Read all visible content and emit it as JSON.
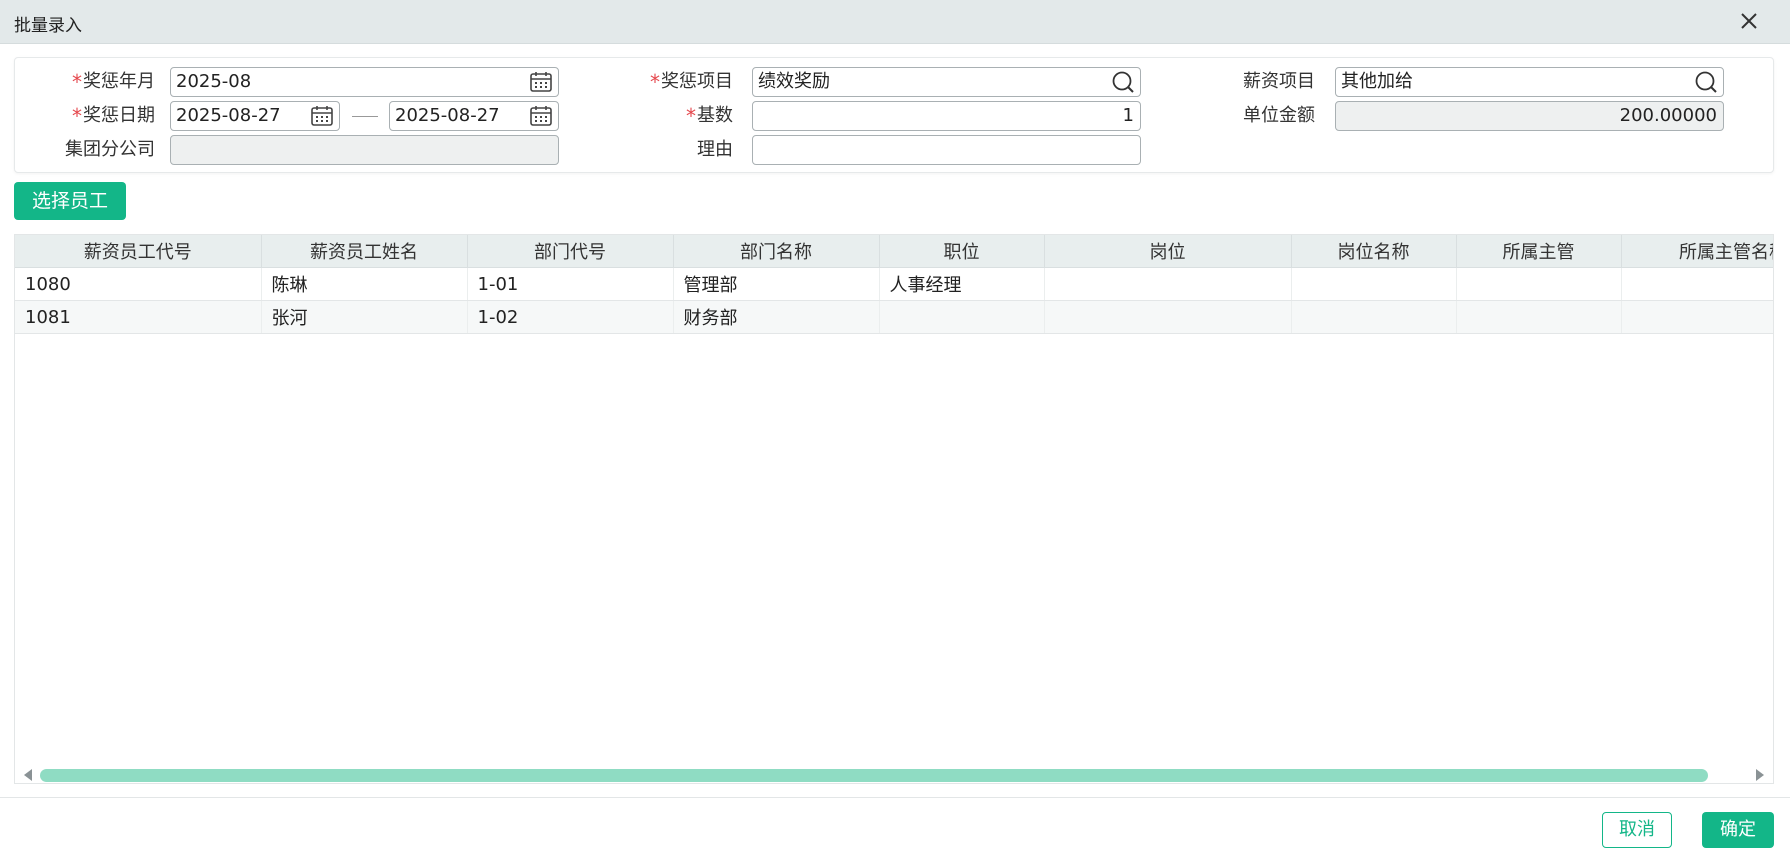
{
  "dialog": {
    "title": "批量录入"
  },
  "form": {
    "reward_month": {
      "label": "奖惩年月",
      "value": "2025-08"
    },
    "reward_date": {
      "label": "奖惩日期",
      "from": "2025-08-27",
      "to": "2025-08-27"
    },
    "group_company": {
      "label": "集团分公司",
      "value": ""
    },
    "reward_item": {
      "label": "奖惩项目",
      "value": "绩效奖励"
    },
    "base_count": {
      "label": "基数",
      "value": "1"
    },
    "reason": {
      "label": "理由",
      "value": ""
    },
    "salary_item": {
      "label": "薪资项目",
      "value": "其他加给"
    },
    "unit_amount": {
      "label": "单位金额",
      "value": "200.00000"
    },
    "required_mark": "*"
  },
  "select_button": "选择员工",
  "table": {
    "columns": [
      "薪资员工代号",
      "薪资员工姓名",
      "部门代号",
      "部门名称",
      "职位",
      "岗位",
      "岗位名称",
      "所属主管",
      "所属主管名称"
    ],
    "rows": [
      [
        "1080",
        "陈琳",
        "1-01",
        "管理部",
        "人事经理",
        "",
        "",
        "",
        ""
      ],
      [
        "1081",
        "张河",
        "1-02",
        "财务部",
        "",
        "",
        "",
        "",
        ""
      ]
    ]
  },
  "footer": {
    "cancel": "取消",
    "confirm": "确定"
  },
  "colors": {
    "accent": "#13b688",
    "required": "#e5484d",
    "header_bg": "#e3e9ea"
  },
  "icons": {
    "close": "close-icon",
    "calendar": "calendar-icon",
    "search": "search-icon"
  }
}
